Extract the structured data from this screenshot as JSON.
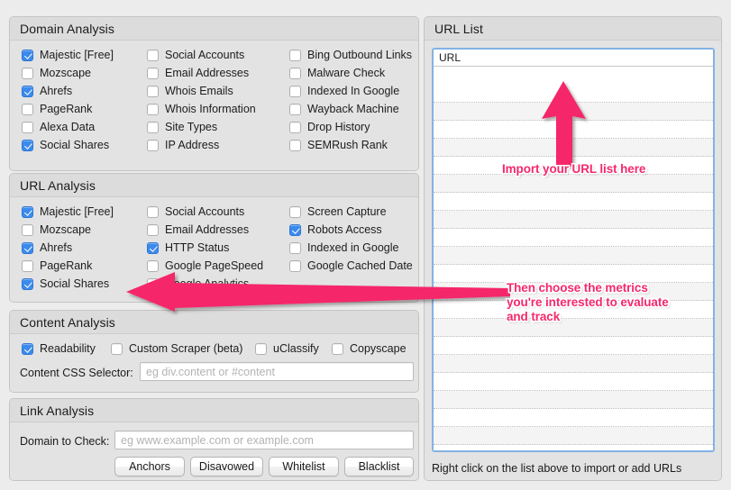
{
  "accent_pink": "#f5286b",
  "accent_blue": "#3b8aed",
  "groups": {
    "domain_analysis": {
      "title": "Domain Analysis",
      "columns": [
        [
          {
            "label": "Majestic [Free]",
            "checked": true
          },
          {
            "label": "Mozscape",
            "checked": false
          },
          {
            "label": "Ahrefs",
            "checked": true
          },
          {
            "label": "PageRank",
            "checked": false
          },
          {
            "label": "Alexa Data",
            "checked": false
          },
          {
            "label": "Social Shares",
            "checked": true
          }
        ],
        [
          {
            "label": "Social Accounts",
            "checked": false
          },
          {
            "label": "Email Addresses",
            "checked": false
          },
          {
            "label": "Whois Emails",
            "checked": false
          },
          {
            "label": "Whois Information",
            "checked": false
          },
          {
            "label": "Site Types",
            "checked": false
          },
          {
            "label": "IP Address",
            "checked": false
          }
        ],
        [
          {
            "label": "Bing Outbound Links",
            "checked": false
          },
          {
            "label": "Malware Check",
            "checked": false
          },
          {
            "label": "Indexed In Google",
            "checked": false
          },
          {
            "label": "Wayback Machine",
            "checked": false
          },
          {
            "label": "Drop History",
            "checked": false
          },
          {
            "label": "SEMRush Rank",
            "checked": false
          }
        ]
      ]
    },
    "url_analysis": {
      "title": "URL Analysis",
      "columns": [
        [
          {
            "label": "Majestic [Free]",
            "checked": true
          },
          {
            "label": "Mozscape",
            "checked": false
          },
          {
            "label": "Ahrefs",
            "checked": true
          },
          {
            "label": "PageRank",
            "checked": false
          },
          {
            "label": "Social Shares",
            "checked": true
          }
        ],
        [
          {
            "label": "Social Accounts",
            "checked": false
          },
          {
            "label": "Email Addresses",
            "checked": false
          },
          {
            "label": "HTTP Status",
            "checked": true
          },
          {
            "label": "Google PageSpeed",
            "checked": false
          },
          {
            "label": "Google Analytics",
            "checked": false
          }
        ],
        [
          {
            "label": "Screen Capture",
            "checked": false
          },
          {
            "label": "Robots Access",
            "checked": true
          },
          {
            "label": "Indexed in Google",
            "checked": false
          },
          {
            "label": "Google Cached Date",
            "checked": false
          }
        ]
      ]
    },
    "content_analysis": {
      "title": "Content Analysis",
      "checkboxes": [
        {
          "label": "Readability",
          "checked": true
        },
        {
          "label": "Custom Scraper (beta)",
          "checked": false
        },
        {
          "label": "uClassify",
          "checked": false
        },
        {
          "label": "Copyscape",
          "checked": false
        }
      ],
      "selector_label": "Content CSS Selector:",
      "selector_value": "",
      "selector_placeholder": "eg div.content or #content"
    },
    "link_analysis": {
      "title": "Link Analysis",
      "domain_label": "Domain to Check:",
      "domain_value": "",
      "domain_placeholder": "eg www.example.com or example.com",
      "buttons": [
        "Anchors",
        "Disavowed",
        "Whitelist",
        "Blacklist"
      ]
    }
  },
  "url_list": {
    "title": "URL List",
    "column_header": "URL",
    "rows": [],
    "hint": "Right click on the list above to import or add URLs"
  },
  "annotations": [
    {
      "id": "import-note",
      "text": "Import your URL list here"
    },
    {
      "id": "metrics-note",
      "text": "Then choose the metrics\nyou're interested to evaluate\nand track"
    }
  ]
}
